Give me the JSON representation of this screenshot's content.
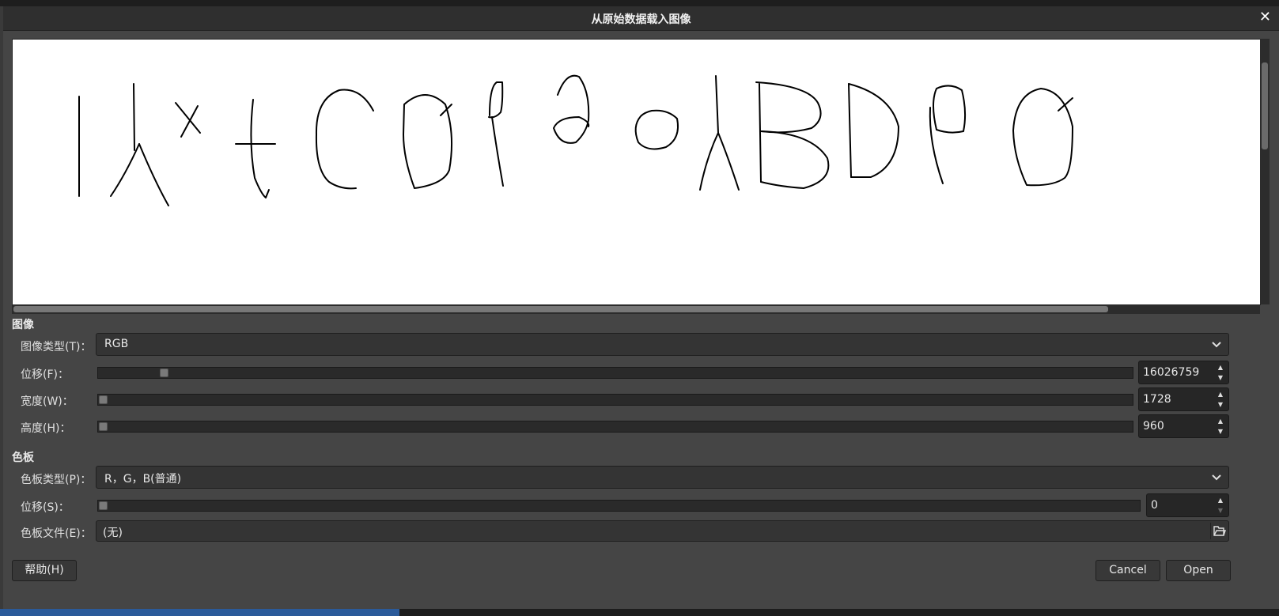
{
  "dialog": {
    "title": "从原始数据载入图像",
    "close_symbol": "✕"
  },
  "image_section": {
    "heading": "图像",
    "image_type": {
      "label": "图像类型(T)：",
      "value": "RGB"
    },
    "offset": {
      "label": "位移(F)：",
      "value": "16026759"
    },
    "width": {
      "label": "宽度(W)：",
      "value": "1728"
    },
    "height": {
      "label": "高度(H)：",
      "value": "960"
    }
  },
  "palette_section": {
    "heading": "色板",
    "palette_type": {
      "label": "色板类型(P)：",
      "value": "R，G，B(普通)"
    },
    "offset": {
      "label": "位移(S)：",
      "value": "0"
    },
    "palette_file": {
      "label": "色板文件(E)：",
      "value": "(无)"
    }
  },
  "buttons": {
    "help": "帮助(H)",
    "cancel": "Cancel",
    "open": "Open"
  },
  "icons": {
    "close": "close-icon",
    "dropdown": "chevron-down-icon",
    "spin_up": "arrow-up-icon",
    "spin_down": "arrow-down-icon",
    "file_browse": "folder-icon"
  },
  "colors": {
    "dialog_bg": "#454545",
    "titlebar_bg": "#2f2f2f",
    "preview_bg": "#ffffff",
    "desktop_blue": "#2a5a9a"
  }
}
